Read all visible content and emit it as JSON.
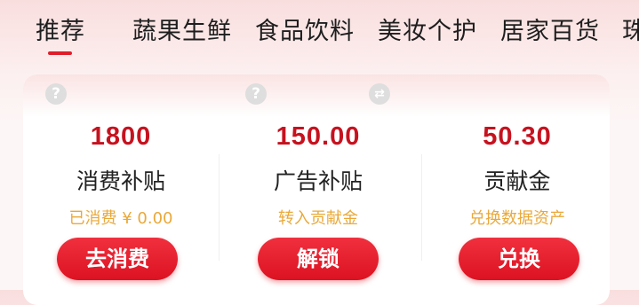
{
  "tabs": [
    {
      "label": "推荐",
      "active": true
    },
    {
      "label": "蔬果生鲜"
    },
    {
      "label": "食品饮料"
    },
    {
      "label": "美妆个护"
    },
    {
      "label": "居家百货"
    },
    {
      "label": "珠"
    }
  ],
  "card": {
    "columns": [
      {
        "amount": "1800",
        "label": "消费补贴",
        "sub": "已消费 ¥ 0.00",
        "button": "去消费",
        "corner_icon": "help-icon"
      },
      {
        "amount": "150.00",
        "label": "广告补贴",
        "sub": "转入贡献金",
        "button": "解锁",
        "corner_icon": "help-icon"
      },
      {
        "amount": "50.30",
        "label": "贡献金",
        "sub": "兑换数据资产",
        "button": "兑换",
        "corner_icon": "swap-icon"
      }
    ]
  },
  "colors": {
    "accent": "#c6121f",
    "button": "#e01e2b",
    "subtext": "#e9a93a"
  }
}
